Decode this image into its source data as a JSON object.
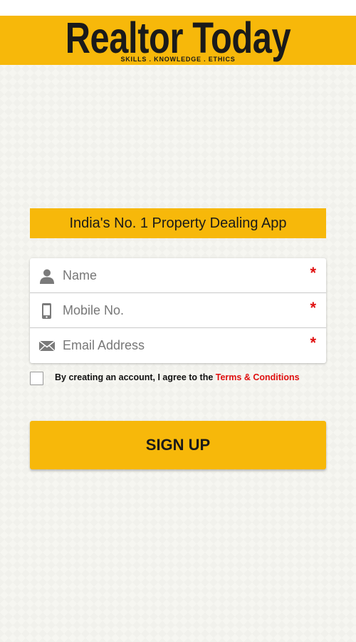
{
  "header": {
    "logo_text": "Realtor Today",
    "tagline": "SKILLS . KNOWLEDGE . ETHICS"
  },
  "banner": {
    "text": "India's No. 1 Property Dealing App"
  },
  "form": {
    "fields": [
      {
        "placeholder": "Name",
        "icon": "person-icon",
        "required_mark": "*"
      },
      {
        "placeholder": "Mobile No.",
        "icon": "mobile-phone-icon",
        "required_mark": "*"
      },
      {
        "placeholder": "Email Address",
        "icon": "envelope-icon",
        "required_mark": "*"
      }
    ]
  },
  "terms": {
    "text": "By creating an account, I agree to the ",
    "link_text": "Terms & Conditions"
  },
  "signup_button": {
    "label": "SIGN UP"
  },
  "colors": {
    "accent": "#f7b80a",
    "required": "#e01010",
    "background": "#f6f6f1"
  }
}
